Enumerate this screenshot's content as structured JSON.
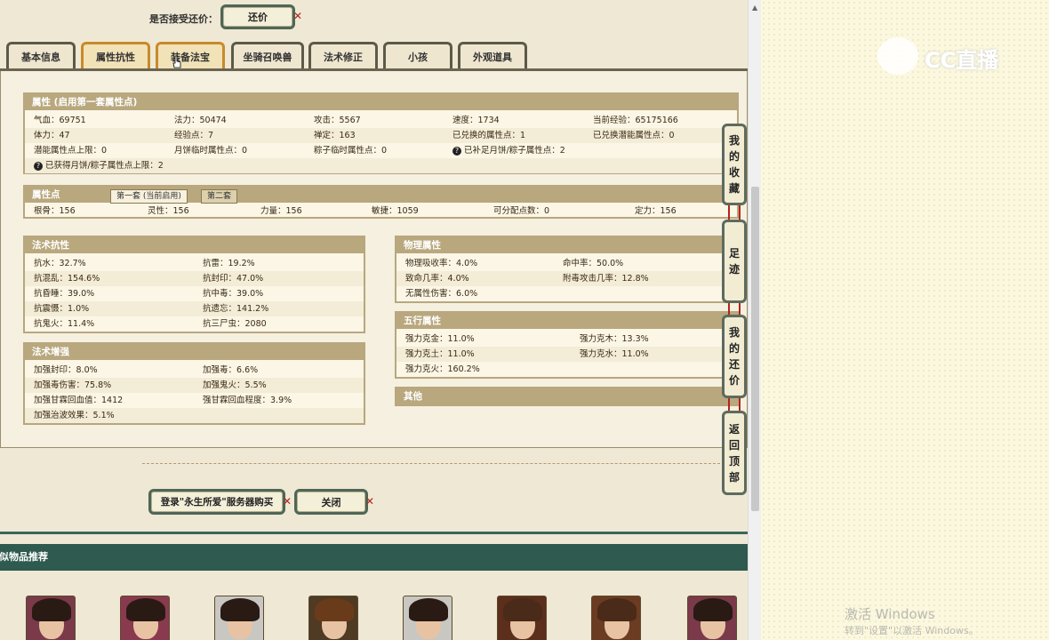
{
  "offer": {
    "label": "是否接受还价：",
    "button": "还价"
  },
  "tabs": [
    "基本信息",
    "属性抗性",
    "装备法宝",
    "坐骑召唤兽",
    "法术修正",
    "小孩",
    "外观道具"
  ],
  "attributes": {
    "title": "属性 (启用第一套属性点)",
    "rows": [
      [
        "气血：69751",
        "法力：50474",
        "攻击：5567",
        "速度：1734",
        "当前经验：65175166"
      ],
      [
        "体力：47",
        "经验点：7",
        "禅定：163",
        "已兑换的属性点：1",
        "已兑换潜能属性点：0"
      ],
      [
        "潜能属性点上限：0",
        "月饼临时属性点：0",
        "粽子临时属性点：0",
        "已补足月饼/粽子属性点：2",
        ""
      ],
      [
        "已获得月饼/粽子属性点上限：2",
        "",
        "",
        "",
        ""
      ]
    ]
  },
  "points": {
    "title": "属性点",
    "subtabs": [
      "第一套 (当前启用)",
      "第二套"
    ],
    "row": [
      "根骨：156",
      "灵性：156",
      "力量：156",
      "敏捷：1059",
      "可分配点数：0",
      "定力：156"
    ]
  },
  "resist": {
    "title": "法术抗性",
    "rows": [
      [
        "抗水：32.7%",
        "抗雷：19.2%"
      ],
      [
        "抗混乱：154.6%",
        "抗封印：47.0%"
      ],
      [
        "抗昏睡：39.0%",
        "抗中毒：39.0%"
      ],
      [
        "抗震慑：1.0%",
        "抗遗忘：141.2%"
      ],
      [
        "抗鬼火：11.4%",
        "抗三尸虫：2080"
      ]
    ]
  },
  "enhance": {
    "title": "法术增强",
    "rows": [
      [
        "加强封印：8.0%",
        "加强毒：6.6%"
      ],
      [
        "加强毒伤害：75.8%",
        "加强鬼火：5.5%"
      ],
      [
        "加强甘霖回血值：1412",
        "强甘霖回血程度：3.9%"
      ],
      [
        "加强治波效果：5.1%",
        ""
      ]
    ]
  },
  "physical": {
    "title": "物理属性",
    "rows": [
      [
        "物理吸收率：4.0%",
        "命中率：50.0%"
      ],
      [
        "致命几率：4.0%",
        "附毒攻击几率：12.8%"
      ],
      [
        "无属性伤害：6.0%",
        ""
      ]
    ]
  },
  "elements": {
    "title": "五行属性",
    "rows": [
      [
        "强力克金：11.0%",
        "强力克木：13.3%"
      ],
      [
        "强力克土：11.0%",
        "强力克水：11.0%"
      ],
      [
        "强力克火：160.2%",
        ""
      ]
    ]
  },
  "other": {
    "title": "其他"
  },
  "side": {
    "fav": [
      "我",
      "的",
      "收",
      "藏"
    ],
    "foot": [
      "足",
      "迹"
    ],
    "mybid": [
      "我",
      "的",
      "还",
      "价"
    ],
    "top": [
      "返",
      "回",
      "顶",
      "部"
    ]
  },
  "actions": {
    "login": "登录\"永生所爱\"服务器购买",
    "close": "关闭"
  },
  "recommend": {
    "title": "相似物品推荐"
  },
  "overlay": {
    "logo": "CC直播",
    "activate": "激活 Windows",
    "activate_sub": "转到\"设置\"以激活 Windows。"
  },
  "avatar_icon": "character-portrait-icon"
}
